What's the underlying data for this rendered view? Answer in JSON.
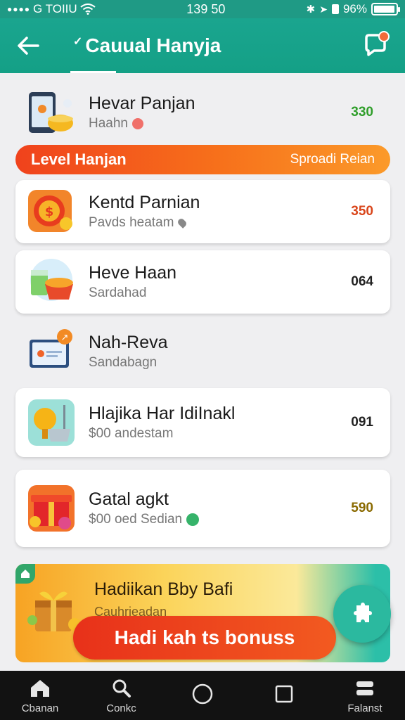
{
  "status_bar": {
    "carrier": "G TOIIU",
    "time": "139 50",
    "battery": "96%",
    "battery_level": 0.96
  },
  "app_bar": {
    "title": "Cauual Hanyja",
    "chat_badge_color": "#f26b3a"
  },
  "items": [
    {
      "title": "Hevar Panjan",
      "subtitle": "Haahn",
      "value": "330",
      "value_color": "#2f9e2a",
      "sub_icon": "fire-icon"
    },
    {
      "title": "Kentd Parnian",
      "subtitle": "Pavds heatam",
      "value": "350",
      "value_color": "#d9451a",
      "sub_icon": "location-pin-icon"
    },
    {
      "title": "Heve Haan",
      "subtitle": "Sardahad",
      "value": "064",
      "value_color": "#222222",
      "sub_icon": ""
    },
    {
      "title": "Nah-Reva",
      "subtitle": "Sandabagn",
      "value": "",
      "value_color": "#222222",
      "sub_icon": ""
    },
    {
      "title": "Hlajika Har IdiInakl",
      "subtitle": "$00 andestam",
      "value": "091",
      "value_color": "#222222",
      "sub_icon": ""
    },
    {
      "title": "Gatal agkt",
      "subtitle": "$00 oed Sedian",
      "value": "590",
      "value_color": "#8a6a00",
      "sub_icon": "check-badge-icon"
    }
  ],
  "level_banner": {
    "label": "Level Hanjan",
    "right_label": "Sproadi Reian"
  },
  "promo": {
    "title": "Hadiikan Bby Bafi",
    "subtitle": "Cauhrieadan",
    "button_label": "Hadi kah ts bonuss"
  },
  "bottom_nav": [
    {
      "label": "Cbanan",
      "icon": "home-icon"
    },
    {
      "label": "Conkc",
      "icon": "search-icon"
    },
    {
      "label": "",
      "icon": "circle-home-icon"
    },
    {
      "label": "",
      "icon": "square-recents-icon"
    },
    {
      "label": "Falanst",
      "icon": "menu-icon"
    }
  ]
}
